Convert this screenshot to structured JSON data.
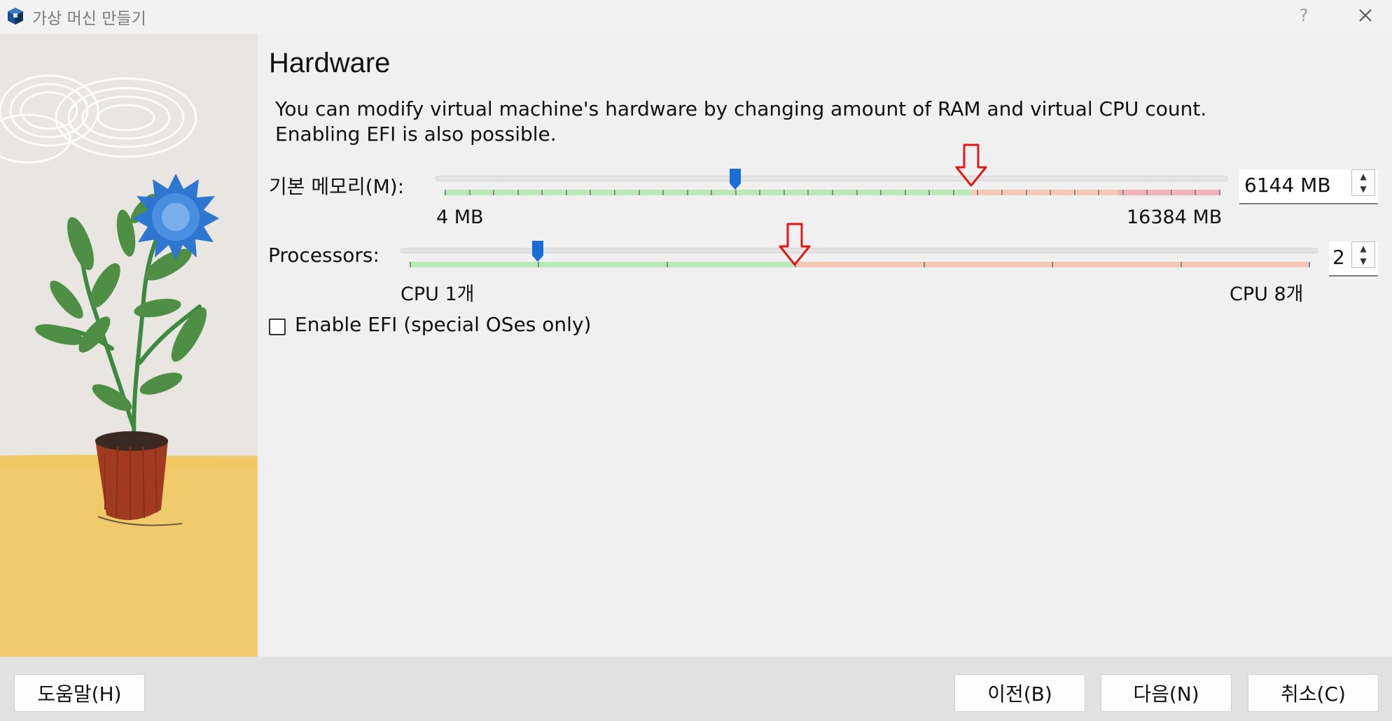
{
  "window": {
    "title": "가상 머신 만들기",
    "help_glyph": "?",
    "icon": "virtualbox-icon"
  },
  "page": {
    "heading": "Hardware",
    "description_line1": "You can modify virtual machine's hardware by changing amount of RAM and virtual CPU count.",
    "description_line2": "Enabling EFI is also possible."
  },
  "memory": {
    "label": "기본 메모리(M):",
    "min_label": "4 MB",
    "max_label": "16384 MB",
    "min": 4,
    "max": 16384,
    "value": 6144,
    "value_text": "6144 MB",
    "recommended_limit_fraction": 0.68,
    "danger_start_fraction": 0.87
  },
  "processors": {
    "label": "Processors:",
    "min_label": "CPU 1개",
    "max_label": "CPU 8개",
    "min": 1,
    "max": 8,
    "value": 2,
    "value_text": "2",
    "recommended_limit": 4
  },
  "efi": {
    "label": "Enable EFI (special OSes only)",
    "checked": false
  },
  "buttons": {
    "help": "도움말(H)",
    "back": "이전(B)",
    "next": "다음(N)",
    "cancel": "취소(C)"
  },
  "colors": {
    "ok_zone": "#b8eab5",
    "warn_zone": "#f6c9b4",
    "danger_zone": "#f2b3bf",
    "handle": "#1a6fd6",
    "annotation_arrow": "#e01818"
  }
}
